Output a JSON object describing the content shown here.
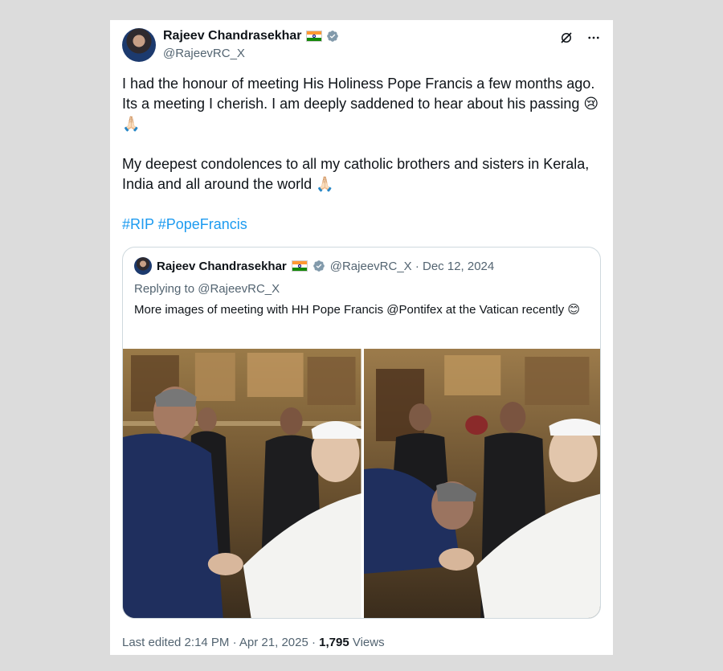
{
  "tweet": {
    "author_name": "Rajeev Chandrasekhar",
    "author_handle": "@RajeevRC_X",
    "text_para1": "I had the honour of meeting His Holiness Pope Francis a few months ago. Its a meeting I cherish. I am deeply saddened to hear about his passing 😢🙏🏻",
    "text_para2": "My deepest condolences to all my catholic brothers and sisters in Kerala, India and all around the world 🙏🏻",
    "hashtags": "#RIP #PopeFrancis",
    "footer_edited": "Last edited 2:14 PM · Apr 21, 2025 · ",
    "views_count": "1,795",
    "views_label": " Views"
  },
  "quoted": {
    "author_name": "Rajeev Chandrasekhar",
    "meta": "@RajeevRC_X · Dec 12, 2024",
    "replying_prefix": "Replying to ",
    "replying_handle": "@RajeevRC_X",
    "text": "More images of meeting with HH Pope Francis @Pontifex at the Vatican recently 😊"
  },
  "icons": {
    "verified": "verified-badge-icon",
    "flag": "india-flag-icon",
    "grok": "grok-icon",
    "more": "more-options-icon"
  },
  "colors": {
    "link": "#1d9bf0",
    "secondary": "#536471",
    "verified": "#829aab"
  }
}
